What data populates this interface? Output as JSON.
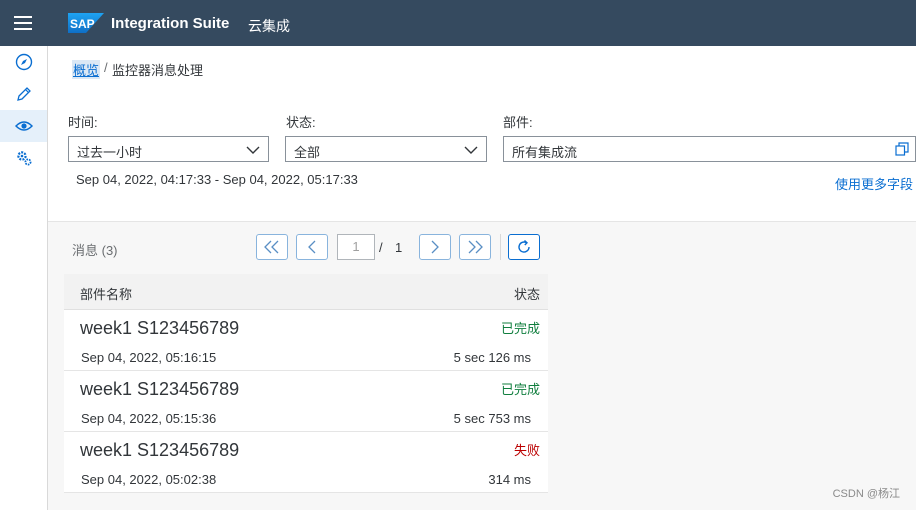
{
  "shell": {
    "logo_text": "SAP",
    "product": "Integration Suite",
    "subproduct": "云集成",
    "brand_color": "#354a5f"
  },
  "sidenav": {
    "items": [
      {
        "icon": "compass-icon",
        "active": false
      },
      {
        "icon": "pencil-icon",
        "active": false
      },
      {
        "icon": "eye-icon",
        "active": true
      },
      {
        "icon": "gears-icon",
        "active": false
      }
    ]
  },
  "breadcrumb": {
    "link": "概览",
    "separator": "/",
    "current": "监控器消息处理"
  },
  "filters": {
    "time": {
      "label": "时间:",
      "value": "过去一小时"
    },
    "status": {
      "label": "状态:",
      "value": "全部"
    },
    "artifact": {
      "label": "部件:",
      "value": "所有集成流"
    },
    "time_range": "Sep 04, 2022, 04:17:33 - Sep 04, 2022, 05:17:33",
    "more_fields": "使用更多字段"
  },
  "messages": {
    "count_label": "消息 (3)",
    "pagination": {
      "current": "1",
      "slash": "/",
      "total": "1"
    },
    "columns": {
      "name": "部件名称",
      "status": "状态"
    },
    "rows": [
      {
        "name": "week1 S123456789",
        "status": "已完成",
        "status_color": "#107e3e",
        "date": "Sep 04, 2022, 05:16:15",
        "duration": "5 sec 126 ms"
      },
      {
        "name": "week1 S123456789",
        "status": "已完成",
        "status_color": "#107e3e",
        "date": "Sep 04, 2022, 05:15:36",
        "duration": "5 sec 753 ms"
      },
      {
        "name": "week1 S123456789",
        "status": "失败",
        "status_color": "#bb0000",
        "date": "Sep 04, 2022, 05:02:38",
        "duration": "314 ms"
      }
    ]
  },
  "watermark": "CSDN @杨江"
}
